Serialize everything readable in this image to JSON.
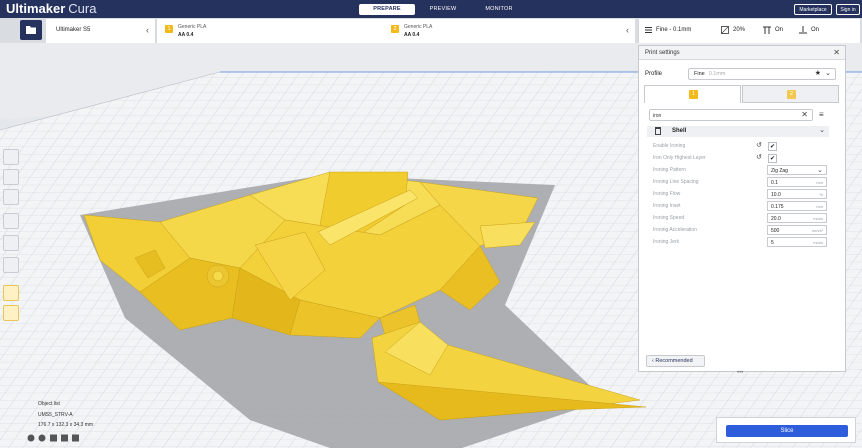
{
  "app": {
    "brand": "Ultimaker",
    "brand_suffix": "Cura"
  },
  "stages": [
    {
      "label": "PREPARE",
      "active": true
    },
    {
      "label": "PREVIEW",
      "active": false
    },
    {
      "label": "MONITOR",
      "active": false
    }
  ],
  "header_buttons": {
    "marketplace": "Marketplace",
    "signin": "Sign in"
  },
  "machine": {
    "name": "Ultimaker S5"
  },
  "extruders": [
    {
      "number": "1",
      "material": "Generic PLA",
      "core": "AA 0.4"
    },
    {
      "number": "2",
      "material": "Generic PLA",
      "core": "AA 0.4"
    }
  ],
  "summary": {
    "profile": "Fine - 0.1mm",
    "infill": "20%",
    "support": "On",
    "adhesion": "On"
  },
  "panel": {
    "title": "Print settings",
    "profile_label": "Profile",
    "profile_value": "Fine",
    "profile_sub": "0.1mm",
    "search_text": "iron",
    "category": "Shell",
    "recommended_label": "Recommended"
  },
  "settings": [
    {
      "label": "Enable Ironing",
      "kind": "check",
      "value": "✔"
    },
    {
      "label": "Iron Only Highest Layer",
      "kind": "check",
      "value": "✔"
    },
    {
      "label": "Ironing Pattern",
      "kind": "select",
      "value": "Zig Zag"
    },
    {
      "label": "Ironing Line Spacing",
      "kind": "number",
      "value": "0.1",
      "unit": "mm"
    },
    {
      "label": "Ironing Flow",
      "kind": "number",
      "value": "10.0",
      "unit": "%"
    },
    {
      "label": "Ironing Inset",
      "kind": "number",
      "value": "0.175",
      "unit": "mm"
    },
    {
      "label": "Ironing Speed",
      "kind": "number",
      "value": "20.0",
      "unit": "mm/s"
    },
    {
      "label": "Ironing Acceleration",
      "kind": "number",
      "value": "500",
      "unit": "mm/s²"
    },
    {
      "label": "Ironing Jerk",
      "kind": "number",
      "value": "5",
      "unit": "mm/s"
    }
  ],
  "object_info": {
    "header": "Object list",
    "file": "UMS5_STRV-A",
    "dims": "176.7 x 132.3 x 34.3 mm"
  },
  "slice": {
    "label": "Slice"
  },
  "colors": {
    "header": "#25325e",
    "accent": "#2e5ddb",
    "model": "#f6d94a",
    "badge": "#f3ba1b"
  },
  "icons": [
    "open-file-icon",
    "translate-icon",
    "scale-icon",
    "rotate-icon",
    "mirror-icon",
    "per-model-settings-icon",
    "support-blocker-icon",
    "profile-icon",
    "infill-icon",
    "support-icon",
    "adhesion-icon",
    "close-icon",
    "star-icon",
    "reset-icon",
    "menu-icon",
    "chevron-icon",
    "view-icon"
  ]
}
